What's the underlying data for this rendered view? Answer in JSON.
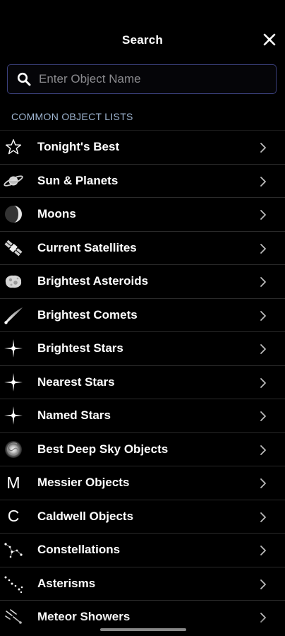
{
  "header": {
    "title": "Search"
  },
  "search": {
    "placeholder": "Enter Object Name",
    "value": ""
  },
  "section": {
    "label": "COMMON OBJECT LISTS"
  },
  "list": {
    "items": [
      {
        "label": "Tonight's Best",
        "icon": "star-outline-icon"
      },
      {
        "label": "Sun & Planets",
        "icon": "planet-icon"
      },
      {
        "label": "Moons",
        "icon": "moon-icon"
      },
      {
        "label": "Current Satellites",
        "icon": "satellite-icon"
      },
      {
        "label": "Brightest Asteroids",
        "icon": "asteroid-icon"
      },
      {
        "label": "Brightest Comets",
        "icon": "comet-icon"
      },
      {
        "label": "Brightest Stars",
        "icon": "star-sparkle-icon"
      },
      {
        "label": "Nearest Stars",
        "icon": "star-sparkle-icon"
      },
      {
        "label": "Named Stars",
        "icon": "star-sparkle-icon"
      },
      {
        "label": "Best Deep Sky Objects",
        "icon": "galaxy-icon"
      },
      {
        "label": "Messier Objects",
        "icon": "messier-letter-icon",
        "glyph": "M"
      },
      {
        "label": "Caldwell Objects",
        "icon": "caldwell-letter-icon",
        "glyph": "C"
      },
      {
        "label": "Constellations",
        "icon": "constellation-icon"
      },
      {
        "label": "Asterisms",
        "icon": "asterism-icon"
      },
      {
        "label": "Meteor Showers",
        "icon": "meteor-icon"
      }
    ]
  },
  "colors": {
    "background": "#000000",
    "search_border": "#3a3f7a",
    "section_label": "#9fb6d2",
    "divider": "#2a2a2a"
  }
}
